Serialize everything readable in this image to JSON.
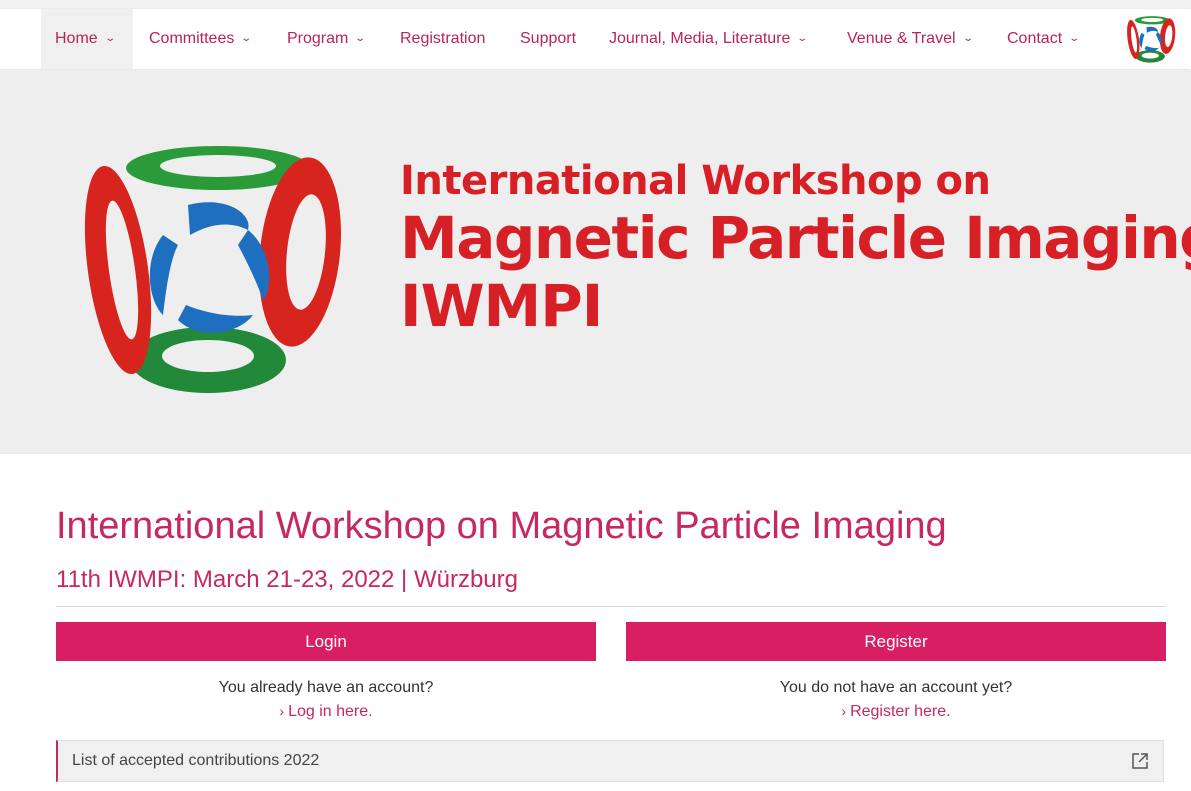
{
  "nav": {
    "items": [
      {
        "label": "Home",
        "dropdown": true,
        "active": true
      },
      {
        "label": "Committees",
        "dropdown": true
      },
      {
        "label": "Program",
        "dropdown": true
      },
      {
        "label": "Registration",
        "dropdown": false
      },
      {
        "label": "Support",
        "dropdown": false
      },
      {
        "label": "Journal, Media, Literature",
        "dropdown": true
      },
      {
        "label": "Venue & Travel",
        "dropdown": true
      },
      {
        "label": "Contact",
        "dropdown": true
      }
    ],
    "logo_icon": "iwmpi-rings-logo-icon"
  },
  "banner": {
    "line1": "International Workshop on",
    "line2": "Magnetic Particle Imaging",
    "line3": "IWMPI",
    "logo_icon": "iwmpi-rings-logo-icon"
  },
  "main": {
    "title": "International Workshop on Magnetic Particle Imaging",
    "subtitle": "11th IWMPI: March 21-23, 2022 | Würzburg",
    "login": {
      "button": "Login",
      "prompt": "You already have an account?",
      "link": "Log in here."
    },
    "register": {
      "button": "Register",
      "prompt": "You do not have an account yet?",
      "link": "Register here."
    },
    "contributions": {
      "label": "List of accepted contributions 2022",
      "icon": "external-link-icon"
    }
  },
  "colors": {
    "accent": "#d81f63",
    "link": "#c7285f",
    "banner_red": "#d71f26",
    "ring_green": "#2a9a3a",
    "ring_blue": "#1f6fc0",
    "hero_bg": "#eeeeee"
  }
}
